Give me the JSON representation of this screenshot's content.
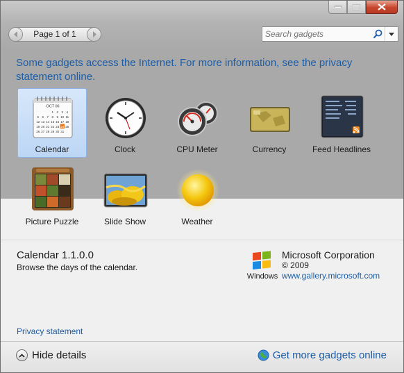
{
  "toolbar": {
    "page_text": "Page 1 of 1",
    "search_placeholder": "Search gadgets"
  },
  "notice": "Some gadgets access the Internet.  For more information, see the privacy statement online.",
  "gadgets": [
    {
      "label": "Calendar",
      "icon": "calendar-icon",
      "selected": true
    },
    {
      "label": "Clock",
      "icon": "clock-icon"
    },
    {
      "label": "CPU Meter",
      "icon": "cpu-meter-icon"
    },
    {
      "label": "Currency",
      "icon": "currency-icon"
    },
    {
      "label": "Feed Headlines",
      "icon": "feed-headlines-icon"
    },
    {
      "label": "Picture Puzzle",
      "icon": "picture-puzzle-icon"
    },
    {
      "label": "Slide Show",
      "icon": "slide-show-icon"
    },
    {
      "label": "Weather",
      "icon": "weather-icon"
    }
  ],
  "calendar_icon": {
    "month": "OCT 06",
    "days": [
      "1",
      "2",
      "3",
      "4",
      "5",
      "6",
      "7",
      "8",
      "9",
      "10",
      "11",
      "12",
      "13",
      "14",
      "15",
      "16",
      "17",
      "18",
      "19",
      "20",
      "21",
      "22",
      "23",
      "24",
      "25",
      "26",
      "27",
      "28",
      "29",
      "30",
      "31"
    ],
    "highlight": "24"
  },
  "details": {
    "title": "Calendar 1.1.0.0",
    "description": "Browse the days of the calendar.",
    "windows_logo_text": "Windows",
    "company": "Microsoft Corporation",
    "year": "© 2009",
    "url": "www.gallery.microsoft.com",
    "privacy": "Privacy statement"
  },
  "footer": {
    "hide_details": "Hide details",
    "get_more": "Get more gadgets online"
  },
  "colors": {
    "link": "#1c5da6",
    "top_bg": "#a9a9a9",
    "selection": "#bcd6f5",
    "close_button": "#c7452c"
  }
}
